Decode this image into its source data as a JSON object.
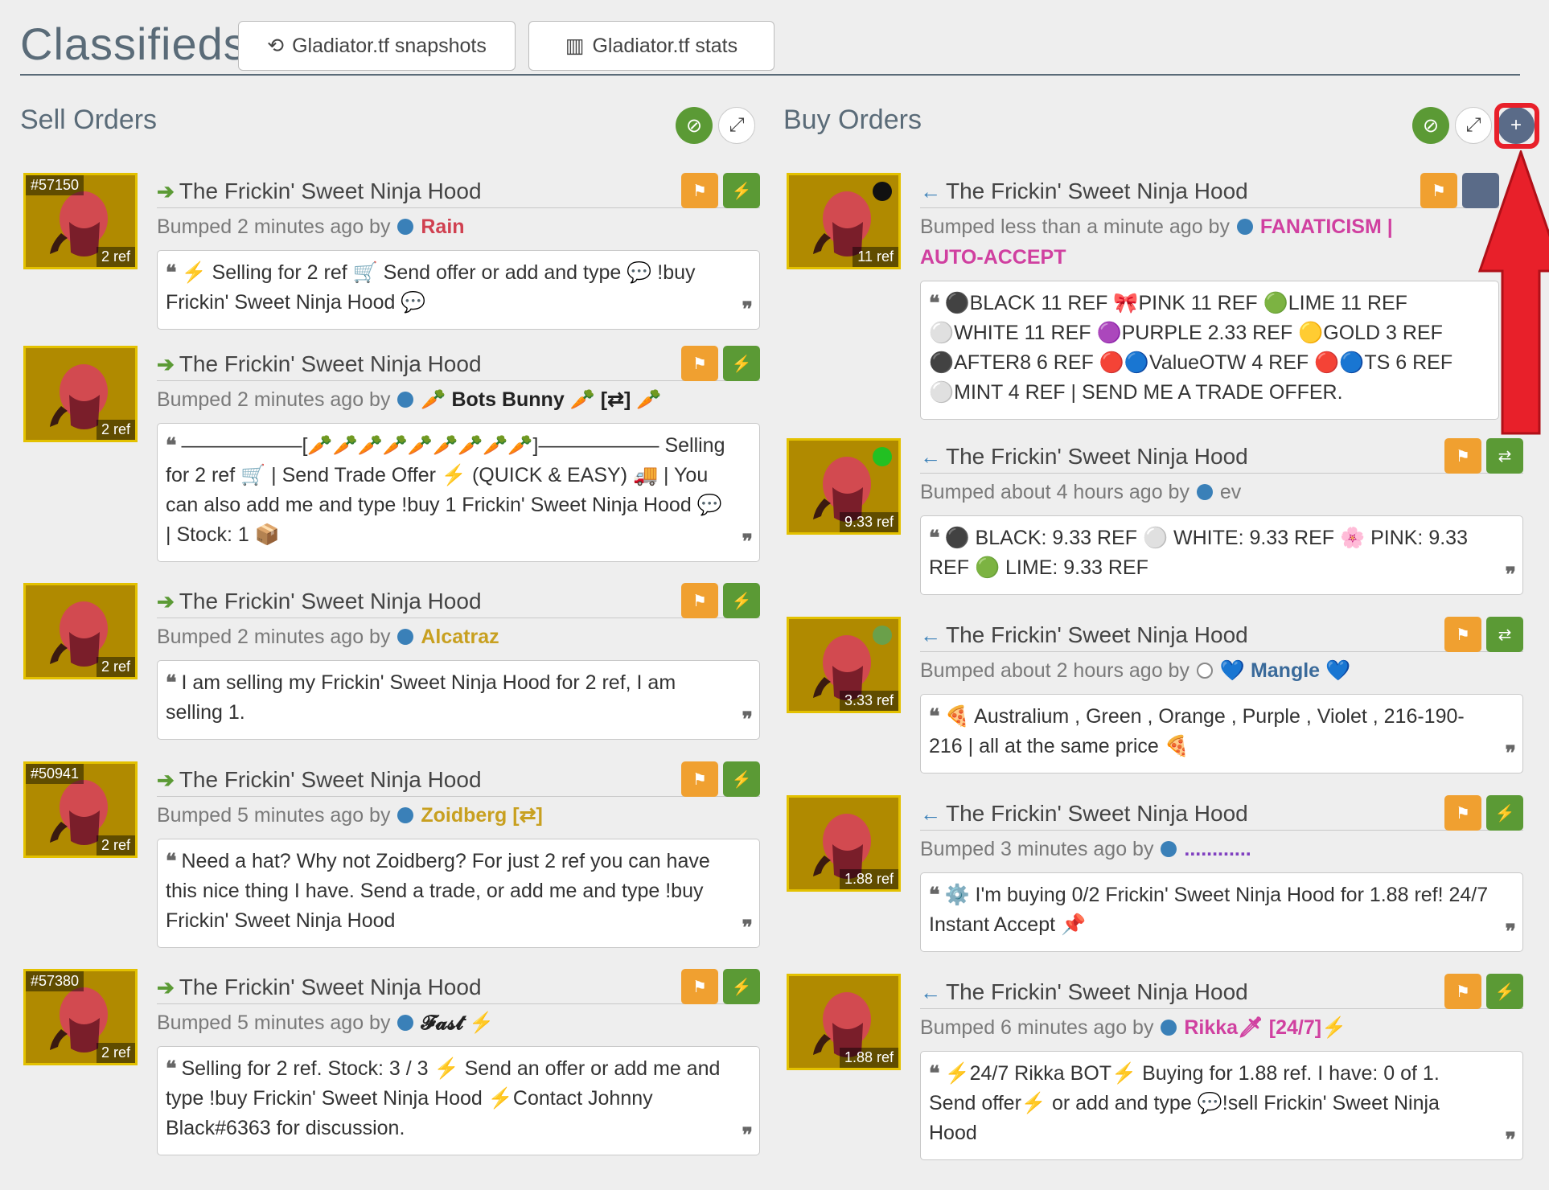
{
  "header": {
    "title": "Classifieds",
    "snapshots_label": "Gladiator.tf snapshots",
    "stats_label": "Gladiator.tf stats"
  },
  "sell": {
    "title": "Sell Orders",
    "listings": [
      {
        "id": "#57150",
        "price": "2 ref",
        "item": "The Frickin' Sweet Ninja Hood",
        "bumped": "Bumped 2 minutes ago by",
        "user": "Rain",
        "user_color": "#d04050",
        "comment": "⚡ Selling for 2 ref 🛒 Send offer or add and type 💬 !buy Frickin' Sweet Ninja Hood 💬"
      },
      {
        "id": "",
        "price": "2 ref",
        "item": "The Frickin' Sweet Ninja Hood",
        "bumped": "Bumped 2 minutes ago by",
        "user": "🥕 Bots Bunny 🥕 [⇄] 🥕",
        "user_color": "#222222",
        "comment": "——————[🥕🥕🥕🥕🥕🥕🥕🥕🥕]—————— Selling for 2 ref 🛒 | Send Trade Offer ⚡ (QUICK & EASY) 🚚 | You can also add me and type !buy 1 Frickin' Sweet Ninja Hood 💬 | Stock: 1 📦"
      },
      {
        "id": "",
        "price": "2 ref",
        "item": "The Frickin' Sweet Ninja Hood",
        "bumped": "Bumped 2 minutes ago by",
        "user": "Alcatraz",
        "user_color": "#c8a020",
        "comment": "I am selling my Frickin' Sweet Ninja Hood for 2 ref, I am selling 1."
      },
      {
        "id": "#50941",
        "price": "2 ref",
        "item": "The Frickin' Sweet Ninja Hood",
        "bumped": "Bumped 5 minutes ago by",
        "user": "Zoidberg [⇄]",
        "user_color": "#c8a020",
        "comment": "Need a hat? Why not Zoidberg? For just 2 ref you can have this nice thing I have. Send a trade, or add me and type !buy Frickin' Sweet Ninja Hood"
      },
      {
        "id": "#57380",
        "price": "2 ref",
        "item": "The Frickin' Sweet Ninja Hood",
        "bumped": "Bumped 5 minutes ago by",
        "user": "𝓕𝓪𝓼𝓽 ⚡",
        "user_color": "#222222",
        "comment": "Selling for 2 ref. Stock: 3 / 3 ⚡ Send an offer or add me and type !buy Frickin' Sweet Ninja Hood ⚡Contact Johnny Black#6363 for discussion."
      }
    ]
  },
  "buy": {
    "title": "Buy Orders",
    "listings": [
      {
        "price": "11 ref",
        "dot": "#111111",
        "item": "The Frickin' Sweet Ninja Hood",
        "bumped": "Bumped less than a minute ago by",
        "user": "FANATICISM | AUTO-ACCEPT",
        "user_color": "#d040a0",
        "comment": "⚫BLACK 11 REF 🎀PINK 11 REF 🟢LIME 11 REF ⚪WHITE 11 REF 🟣PURPLE 2.33 REF 🟡GOLD 3 REF ⚫AFTER8 6 REF 🔴🔵ValueOTW 4 REF 🔴🔵TS 6 REF ⚪MINT 4 REF | SEND ME A TRADE OFFER."
      },
      {
        "price": "9.33 ref",
        "dot": "#22c022",
        "item": "The Frickin' Sweet Ninja Hood",
        "bumped": "Bumped about 4 hours ago by",
        "user": "ev",
        "user_color": "#7a7a7a",
        "comment": "⚫ BLACK: 9.33 REF ⚪ WHITE: 9.33 REF 🌸 PINK: 9.33 REF 🟢 LIME: 9.33 REF"
      },
      {
        "price": "3.33 ref",
        "dot": "#6aa04a",
        "item": "The Frickin' Sweet Ninja Hood",
        "bumped": "Bumped about 2 hours ago by",
        "user": "💙 Mangle 💙",
        "user_color": "#3a6a9a",
        "comment": "🍕 Australium , Green , Orange , Purple , Violet , 216-190-216 | all at the same price 🍕"
      },
      {
        "price": "1.88 ref",
        "dot": "",
        "item": "The Frickin' Sweet Ninja Hood",
        "bumped": "Bumped 3 minutes ago by",
        "user": "............",
        "user_color": "#8040c0",
        "comment": "⚙️ I'm buying 0/2 Frickin' Sweet Ninja Hood for 1.88 ref! 24/7 Instant Accept 📌"
      },
      {
        "price": "1.88 ref",
        "dot": "",
        "item": "The Frickin' Sweet Ninja Hood",
        "bumped": "Bumped 6 minutes ago by",
        "user": "Rikka🗡 [24/7]⚡",
        "user_color": "#d040a0",
        "comment": "⚡24/7 Rikka BOT⚡ Buying for 1.88 ref. I have: 0 of 1. Send offer⚡ or add and type 💬!sell Frickin' Sweet Ninja Hood"
      }
    ]
  }
}
